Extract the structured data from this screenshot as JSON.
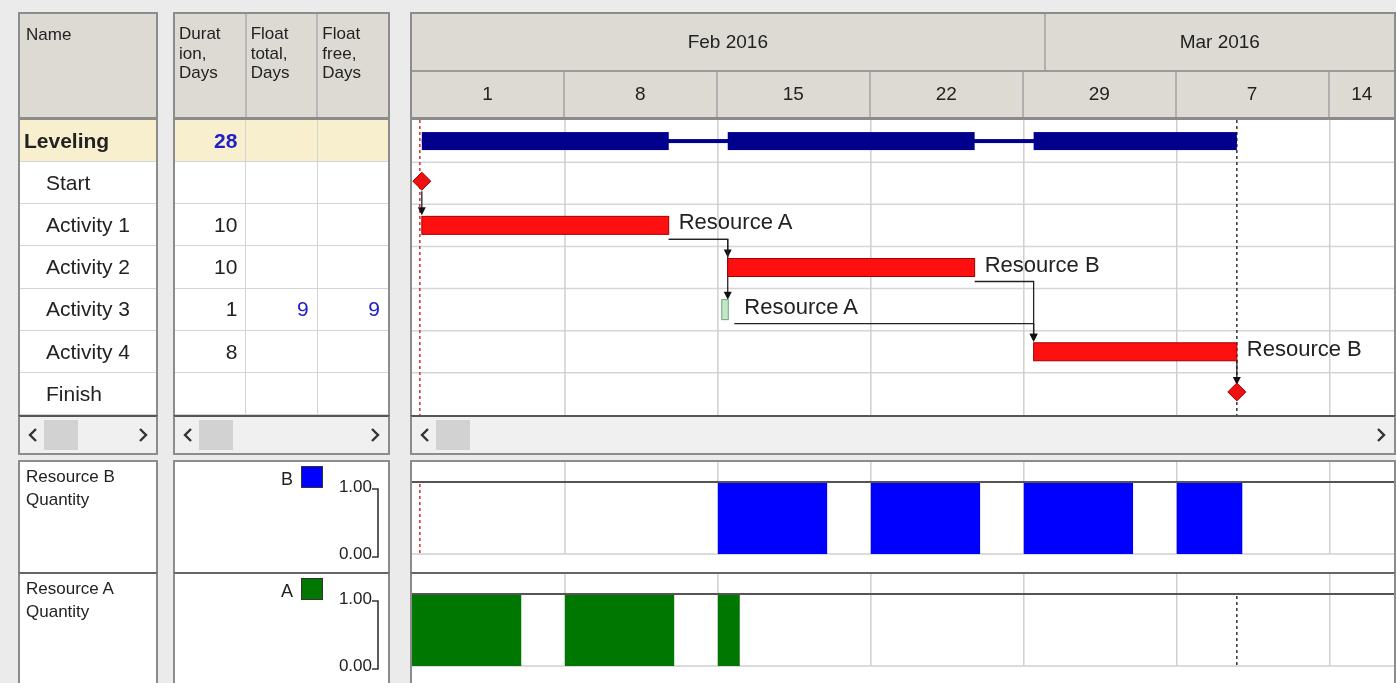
{
  "columns": {
    "name": "Name",
    "data": [
      {
        "label_lines": [
          "Durat",
          "ion,",
          "Days"
        ]
      },
      {
        "label_lines": [
          "Float",
          "total,",
          "Days"
        ]
      },
      {
        "label_lines": [
          "Float",
          "free,",
          "Days"
        ]
      }
    ]
  },
  "timeline": {
    "months": [
      {
        "label": "Feb 2016"
      },
      {
        "label": "Mar 2016"
      }
    ],
    "weeks": [
      {
        "label": "1"
      },
      {
        "label": "8"
      },
      {
        "label": "15"
      },
      {
        "label": "22"
      },
      {
        "label": "29"
      },
      {
        "label": "7"
      },
      {
        "label": "14"
      }
    ]
  },
  "tasks": [
    {
      "name": "Leveling",
      "kind": "summary",
      "duration": "28",
      "selected": true,
      "children": [
        {
          "name": "Start",
          "kind": "milestone",
          "selected": false
        },
        {
          "name": "Activity 1",
          "kind": "task",
          "duration": "10",
          "critical": true,
          "resource": "Resource A",
          "selected": false
        },
        {
          "name": "Activity 2",
          "kind": "task",
          "duration": "10",
          "critical": true,
          "resource": "Resource B",
          "selected": false
        },
        {
          "name": "Activity 3",
          "kind": "task",
          "duration": "1",
          "float_total": "9",
          "float_free": "9",
          "critical": false,
          "resource": "Resource A",
          "selected": false
        },
        {
          "name": "Activity 4",
          "kind": "task",
          "duration": "8",
          "critical": true,
          "resource": "Resource B",
          "selected": false
        },
        {
          "name": "Finish",
          "kind": "milestone",
          "selected": false
        }
      ]
    }
  ],
  "resources": [
    {
      "name": "Resource B Quantity",
      "legend": "B",
      "color": "#0000ff",
      "scale_max": "1.00",
      "scale_min": "0.00"
    },
    {
      "name": "Resource A Quantity",
      "legend": "A",
      "color": "#007700",
      "scale_max": "1.00",
      "scale_min": "0.00"
    }
  ]
}
